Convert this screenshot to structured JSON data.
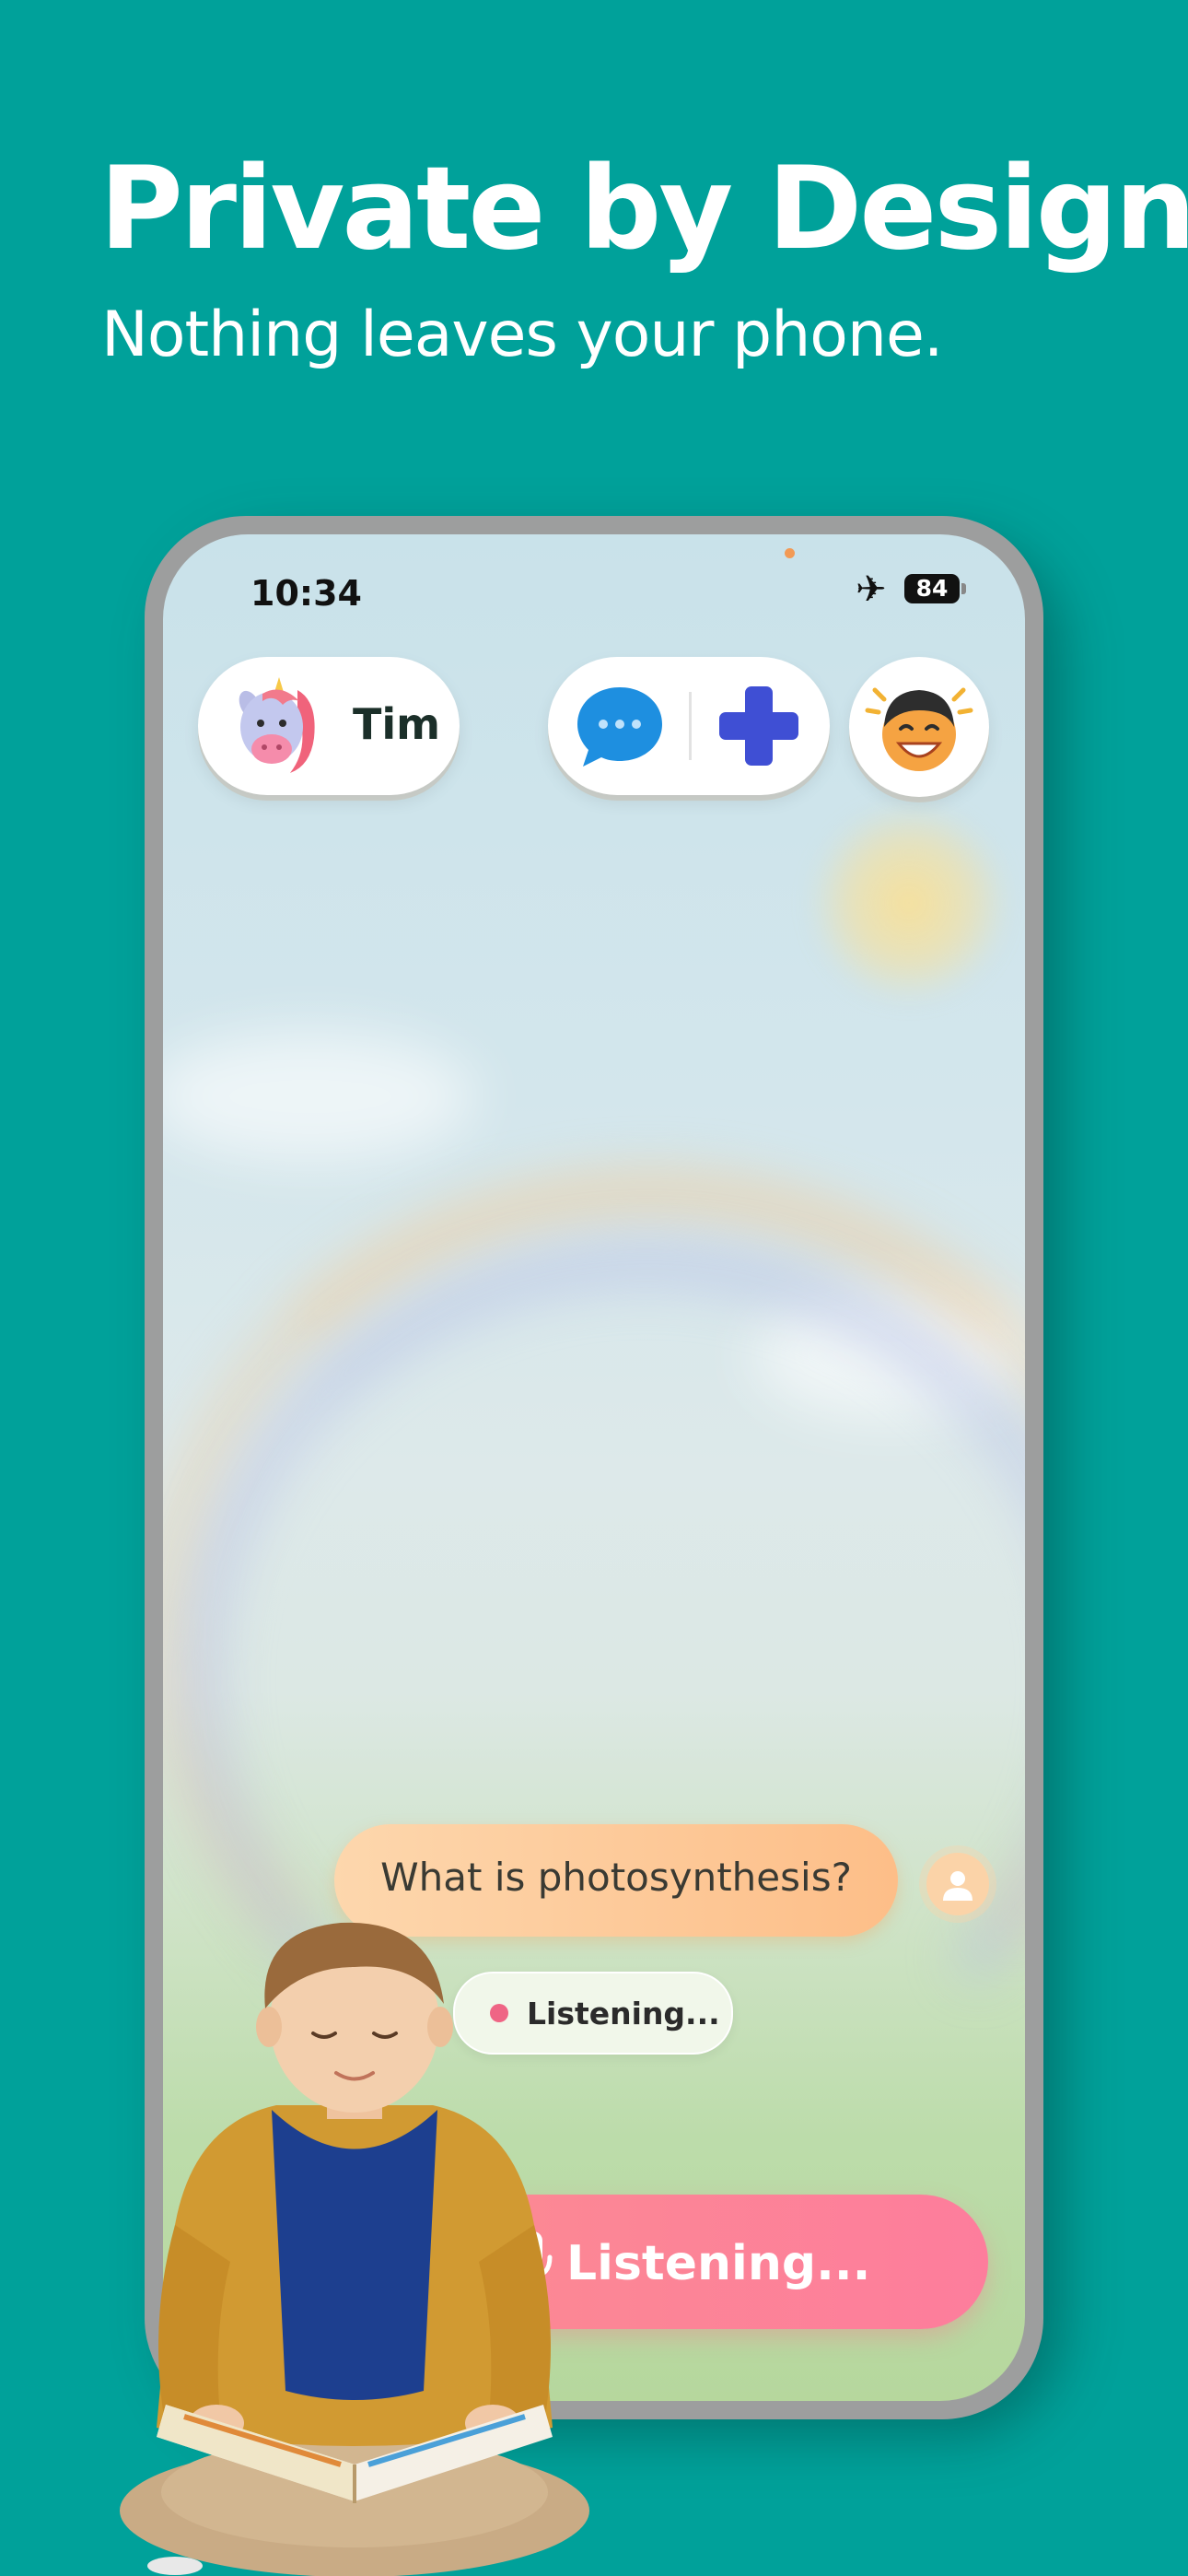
{
  "promo": {
    "headline": "Private by Design",
    "subheadline": "Nothing leaves your phone."
  },
  "status_bar": {
    "time": "10:34",
    "battery": "84",
    "airplane_icon": "airplane-icon"
  },
  "profile": {
    "name": "Tim",
    "avatar_icon": "unicorn-icon"
  },
  "actions": {
    "chat_icon": "chat-bubble-icon",
    "add_icon": "plus-icon",
    "mascot_icon": "smiling-boy-face-icon"
  },
  "conversation": {
    "question": "What is photosynthesis?",
    "status_chip": "Listening..."
  },
  "mic_button": {
    "label": "Listening...",
    "icon": "microphone-icon"
  },
  "colors": {
    "background": "#00A19A",
    "accent_pink": "#FD7D9C",
    "accent_orange": "#FDBE88",
    "chat_blue": "#1E8FE0",
    "plus_blue": "#3F4FD4"
  }
}
